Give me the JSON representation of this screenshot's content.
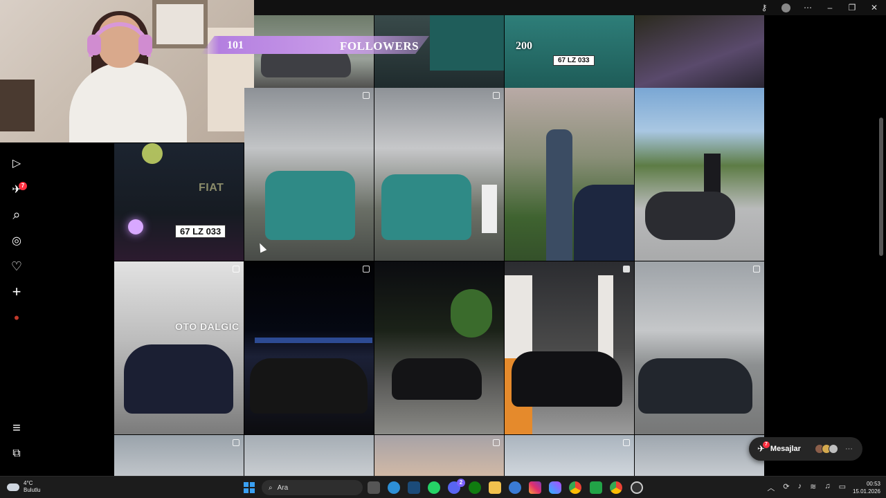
{
  "window": {
    "titlebar_icons": [
      "key-icon",
      "profile-avatar",
      "more-icon",
      "minimize-icon",
      "restore-icon",
      "close-icon"
    ]
  },
  "stream_overlay": {
    "follower_count": "101",
    "follower_label": "FOLLOWERS",
    "follower_goal": "200"
  },
  "sidebar": {
    "items": [
      {
        "name": "reels-icon",
        "glyph": "▷"
      },
      {
        "name": "messages-icon",
        "glyph": "✈",
        "badge": "7"
      },
      {
        "name": "search-icon",
        "glyph": "⌕"
      },
      {
        "name": "explore-icon",
        "glyph": "◎"
      },
      {
        "name": "notifications-icon",
        "glyph": "♡"
      },
      {
        "name": "create-icon",
        "glyph": "+"
      },
      {
        "name": "profile-icon",
        "glyph": "•"
      }
    ],
    "bottom": [
      {
        "name": "menu-icon",
        "glyph": "≡"
      },
      {
        "name": "apps-icon",
        "glyph": "⧉"
      }
    ]
  },
  "grid": {
    "plates": [
      "67 LZ 033",
      "67 LZ 033"
    ],
    "sign_text": "OTO DALGIC",
    "brand_text": "FIAT"
  },
  "messages_pill": {
    "label": "Mesajlar",
    "badge": "7",
    "more": "···"
  },
  "taskbar": {
    "weather_temp": "4°C",
    "weather_desc": "Bulutlu",
    "search_label": "Ara",
    "time": "00:53",
    "date": "15.01.2026",
    "chat_badge": "2"
  },
  "colors": {
    "accent": "#b47fe0",
    "badge": "#ff3040",
    "teal_van": "#2f8a86"
  }
}
